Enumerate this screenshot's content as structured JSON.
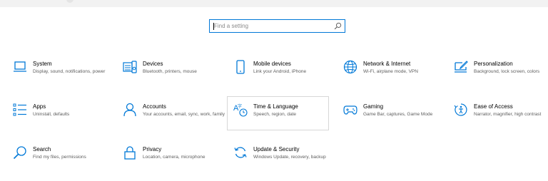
{
  "search": {
    "placeholder": "Find a setting",
    "value": ""
  },
  "tiles": [
    {
      "id": "system",
      "icon": "laptop-icon",
      "title": "System",
      "desc": "Display, sound, notifications, power"
    },
    {
      "id": "devices",
      "icon": "keyboard-speaker-icon",
      "title": "Devices",
      "desc": "Bluetooth, printers, mouse"
    },
    {
      "id": "mobile",
      "icon": "phone-icon",
      "title": "Mobile devices",
      "desc": "Link your Android, iPhone"
    },
    {
      "id": "network",
      "icon": "globe-icon",
      "title": "Network & Internet",
      "desc": "Wi-Fi, airplane mode, VPN"
    },
    {
      "id": "personalization",
      "icon": "paintbrush-monitor-icon",
      "title": "Personalization",
      "desc": "Background, lock screen, colors"
    },
    {
      "id": "apps",
      "icon": "apps-list-icon",
      "title": "Apps",
      "desc": "Uninstall, defaults"
    },
    {
      "id": "accounts",
      "icon": "person-icon",
      "title": "Accounts",
      "desc": "Your accounts, email, sync, work, family"
    },
    {
      "id": "time-language",
      "icon": "time-language-icon",
      "title": "Time & Language",
      "desc": "Speech, region, date"
    },
    {
      "id": "gaming",
      "icon": "gamepad-icon",
      "title": "Gaming",
      "desc": "Game Bar, captures, Game Mode"
    },
    {
      "id": "ease-of-access",
      "icon": "ease-of-access-icon",
      "title": "Ease of Access",
      "desc": "Narrator, magnifier, high contrast"
    },
    {
      "id": "search",
      "icon": "search-icon",
      "title": "Search",
      "desc": "Find my files, permissions"
    },
    {
      "id": "privacy",
      "icon": "lock-icon",
      "title": "Privacy",
      "desc": "Location, camera, microphone"
    },
    {
      "id": "update-security",
      "icon": "refresh-icon",
      "title": "Update & Security",
      "desc": "Windows Update, recovery, backup"
    }
  ],
  "colors": {
    "accent": "#0078d7",
    "description": "#5d5d5d",
    "tile_border": "#d7d7d7"
  }
}
